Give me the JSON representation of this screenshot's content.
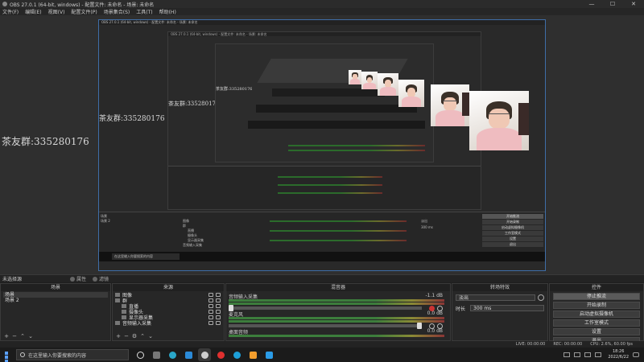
{
  "window": {
    "title": "OBS 27.0.1 (64-bit, windows) - 配置文件: 未命名 - 场景: 未命名"
  },
  "controls_win": {
    "minimize": "—",
    "maximize": "☐",
    "close": "✕"
  },
  "menu": [
    "文件(F)",
    "编辑(E)",
    "视图(V)",
    "配置文件(P)",
    "场景集合(S)",
    "工具(T)",
    "帮助(H)"
  ],
  "preview": {
    "watermark": "茶友群:335280176",
    "nested_title_1": "OBS 27.0.1 (64-bit, windows) - 配置文件: 未命名 - 场景: 未命名",
    "nested_title_2": "OBS 27.0.1 (64-bit, windows) - 配置文件: 未命名 - 场景: 未命名",
    "mini_docks": [
      "场景",
      "来源",
      "混音器",
      "转场特效",
      "控件"
    ],
    "mini_scenes": [
      "场景",
      "场景 2"
    ],
    "mini_sources": [
      "图像",
      "群",
      "直播",
      "摄像头",
      "显示器采集",
      "音频输入采集"
    ],
    "mini_controls": [
      "开始推流",
      "开始录制",
      "启动虚拟摄像机",
      "工作室模式",
      "设置",
      "退出"
    ],
    "mini_search": "在这里输入你要搜索的内容",
    "mini_trans": "淡出",
    "mini_duration": "300 ms"
  },
  "scene_bar": {
    "label": "未选择源",
    "properties": "属性",
    "filters": "滤镜"
  },
  "docks": {
    "scenes": {
      "title": "场景",
      "items": [
        "场景",
        "场景 2"
      ]
    },
    "sources": {
      "title": "来源",
      "items": [
        {
          "name": "图像",
          "indent": 0
        },
        {
          "name": "群",
          "indent": 0
        },
        {
          "name": "直播",
          "indent": 1
        },
        {
          "name": "摄像头",
          "indent": 1
        },
        {
          "name": "显示器采集",
          "indent": 1
        },
        {
          "name": "音频输入采集",
          "indent": 0
        }
      ]
    },
    "mixer": {
      "title": "混音器",
      "channels": [
        {
          "name": "音频输入采集",
          "db": "-1.1 dB"
        },
        {
          "name": "麦克风",
          "db": "0.0 dB"
        },
        {
          "name": "桌面音频",
          "db": "0.0 dB"
        }
      ]
    },
    "transitions": {
      "title": "转场特效",
      "selected": "淡出",
      "duration_label": "时长",
      "duration": "300 ms"
    },
    "controls": {
      "title": "控件",
      "buttons": [
        "停止推流",
        "开始录制",
        "启动虚拟摄像机",
        "工作室模式",
        "设置",
        "退出"
      ]
    }
  },
  "status": {
    "live": "LIVE: 00:00:00",
    "rec": "REC: 00:00:00",
    "cpu": "CPU: 2.6%, 60.00 fps"
  },
  "taskbar": {
    "search_placeholder": "在这里输入你要搜索的内容",
    "time": "18:26",
    "date": "2022/6/22"
  }
}
